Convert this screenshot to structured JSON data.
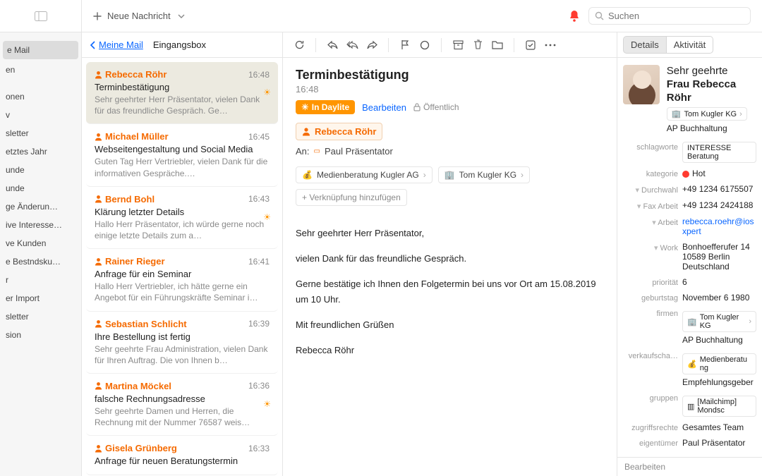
{
  "topbar": {
    "new_message": "Neue Nachricht",
    "search_placeholder": "Suchen"
  },
  "sidebar": {
    "items": [
      {
        "label": "e Mail",
        "selected": true
      },
      {
        "label": "en"
      },
      {
        "label": ""
      },
      {
        "label": "onen"
      },
      {
        "label": "v"
      },
      {
        "label": "sletter"
      },
      {
        "label": "etztes Jahr"
      },
      {
        "label": "unde"
      },
      {
        "label": "unde"
      },
      {
        "label": "ge Änderun…"
      },
      {
        "label": "ive Interesse…"
      },
      {
        "label": "ve Kunden"
      },
      {
        "label": "e Bestndsku…"
      },
      {
        "label": "r"
      },
      {
        "label": "er Import"
      },
      {
        "label": "sletter"
      },
      {
        "label": "sion"
      }
    ]
  },
  "listhead": {
    "back": "Meine Mail",
    "folder": "Eingangsbox"
  },
  "messages": [
    {
      "sender": "Rebecca Röhr",
      "time": "16:48",
      "subject": "Terminbestätigung",
      "preview": "Sehr geehrter Herr Präsentator, vielen Dank für das freundliche Gespräch. Ge…",
      "selected": true,
      "flag": true
    },
    {
      "sender": "Michael Müller",
      "time": "16:45",
      "subject": "Webseitengestaltung und Social Media",
      "preview": "Guten Tag Herr Vertriebler, vielen Dank für die informativen Gespräche.…",
      "flag": false
    },
    {
      "sender": "Bernd Bohl",
      "time": "16:43",
      "subject": "Klärung letzter Details",
      "preview": "Hallo Herr Präsentator, ich würde gerne noch einige letzte Details zum a…",
      "flag": true
    },
    {
      "sender": "Rainer Rieger",
      "time": "16:41",
      "subject": "Anfrage für ein Seminar",
      "preview": "Hallo Herr Vertriebler, ich hätte gerne ein Angebot für ein Führungskräfte Seminar i…",
      "flag": false
    },
    {
      "sender": "Sebastian Schlicht",
      "time": "16:39",
      "subject": "Ihre Bestellung ist fertig",
      "preview": "Sehr geehrte Frau Administration, vielen Dank für Ihren Auftrag. Die von Ihnen b…",
      "flag": false
    },
    {
      "sender": "Martina Möckel",
      "time": "16:36",
      "subject": "falsche Rechnungsadresse",
      "preview": "Sehr geehrte Damen und Herren, die Rechnung mit der Nummer 76587 weis…",
      "flag": true
    },
    {
      "sender": "Gisela Grünberg",
      "time": "16:33",
      "subject": "Anfrage für neuen Beratungstermin",
      "preview": "",
      "flag": false
    }
  ],
  "reader": {
    "subject": "Terminbestätigung",
    "time": "16:48",
    "daylite_badge": "In Daylite",
    "edit": "Bearbeiten",
    "public": "Öffentlich",
    "from": "Rebecca Röhr",
    "to_label": "An:",
    "to_name": "Paul Präsentator",
    "tags": [
      {
        "icon": "💰",
        "label": "Medienberatung Kugler AG"
      },
      {
        "icon": "🏢",
        "label": "Tom Kugler KG"
      }
    ],
    "add_link": "+ Verknüpfung hinzufügen",
    "body": [
      "Sehr geehrter Herr Präsentator,",
      "vielen Dank für das freundliche Gespräch.",
      "Gerne bestätige ich Ihnen den Folgetermin bei uns vor Ort am 15.08.2019 um 10 Uhr.",
      "Mit freundlichen Grüßen",
      "Rebecca Röhr"
    ]
  },
  "inspector": {
    "tabs": {
      "details": "Details",
      "activity": "Aktivität"
    },
    "salutation": "Sehr geehrte",
    "name": "Frau Rebecca Röhr",
    "company_chip": "Tom Kugler KG",
    "role": "AP Buchhaltung",
    "fields": {
      "schlagworte_label": "schlagworte",
      "schlagworte": "INTERESSE Beratung",
      "kategorie_label": "kategorie",
      "kategorie": "Hot",
      "durchwahl_label": "Durchwahl",
      "durchwahl": "+49 1234 6175507",
      "fax_label": "Fax Arbeit",
      "fax": "+49 1234 2424188",
      "arbeit_label": "Arbeit",
      "arbeit": "rebecca.roehr@iosxpert",
      "work_label": "Work",
      "work_addr1": "Bonhoefferufer 14",
      "work_addr2": "10589 Berlin",
      "work_addr3": "Deutschland",
      "prioritaet_label": "priorität",
      "prioritaet": "6",
      "geburtstag_label": "geburtstag",
      "geburtstag": "November  6   1980",
      "firmen_label": "firmen",
      "firmen_chip": "Tom Kugler KG",
      "firmen_role": "AP Buchhaltung",
      "verkaufs_label": "verkaufscha…",
      "verkaufs_chip": "Medienberatung",
      "verkaufs_extra": "Empfehlungsgeber",
      "gruppen_label": "gruppen",
      "gruppen_chip": "[Mailchimp] Mondsc",
      "zugriff_label": "zugriffsrechte",
      "zugriff": "Gesamtes Team",
      "owner_label": "eigentümer",
      "owner": "Paul Präsentator"
    },
    "footer": "Bearbeiten"
  }
}
